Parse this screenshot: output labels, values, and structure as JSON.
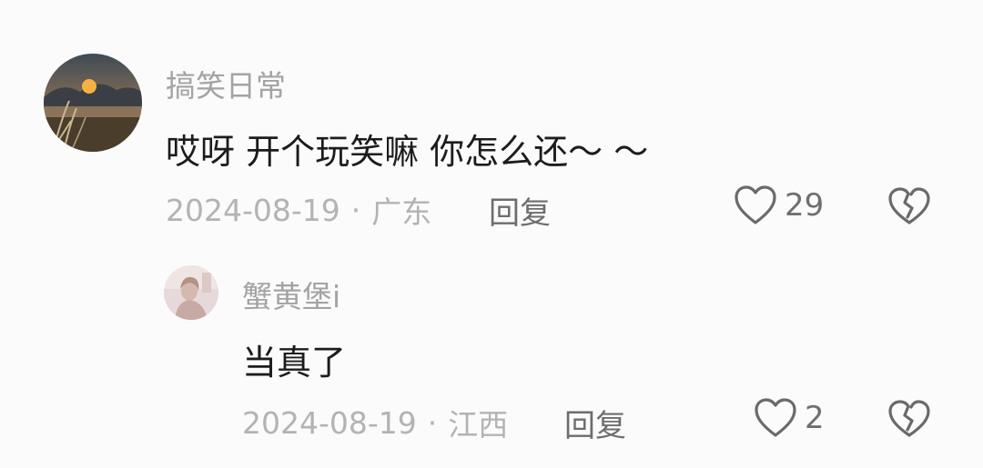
{
  "cut_text": "",
  "comments": [
    {
      "username": "搞笑日常",
      "content": "哎呀  开个玩笑嘛   你怎么还～ ～",
      "date": "2024-08-19",
      "separator": "·",
      "location": "广东",
      "reply_label": "回复",
      "like_count": "29",
      "avatar": "sunset-landscape-avatar"
    },
    {
      "username": "蟹黄堡i",
      "content": "当真了",
      "date": "2024-08-19",
      "separator": "·",
      "location": "江西",
      "reply_label": "回复",
      "like_count": "2",
      "avatar": "person-photo-avatar"
    }
  ],
  "icons": {
    "like": "heart-outline-icon",
    "dislike": "broken-heart-icon"
  },
  "colors": {
    "background": "#fbfbfb",
    "username": "#a3a3a3",
    "content": "#1c1c1c",
    "meta": "#b3b3b3",
    "action": "#6d6d6d"
  }
}
